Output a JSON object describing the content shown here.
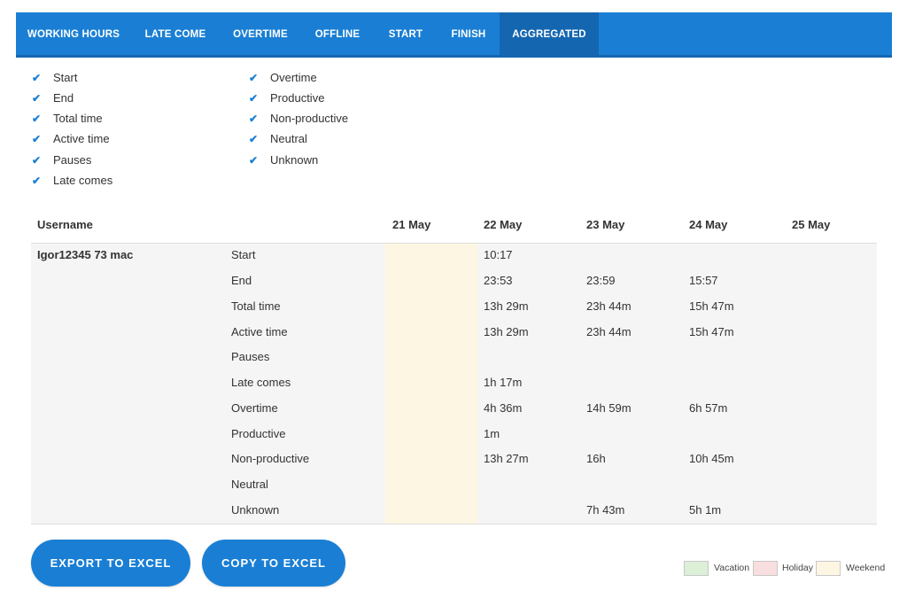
{
  "tabs": [
    {
      "label": "WORKING HOURS"
    },
    {
      "label": "LATE COME"
    },
    {
      "label": "OVERTIME"
    },
    {
      "label": "OFFLINE"
    },
    {
      "label": "START"
    },
    {
      "label": "FINISH"
    },
    {
      "label": "AGGREGATED",
      "active": true
    }
  ],
  "filters": {
    "left": [
      {
        "label": "Start",
        "checked": true
      },
      {
        "label": "End",
        "checked": true
      },
      {
        "label": "Total time",
        "checked": true
      },
      {
        "label": "Active time",
        "checked": true
      },
      {
        "label": "Pauses",
        "checked": true
      },
      {
        "label": "Late comes",
        "checked": true
      }
    ],
    "right": [
      {
        "label": "Overtime",
        "checked": true
      },
      {
        "label": "Productive",
        "checked": true
      },
      {
        "label": "Non-productive",
        "checked": true
      },
      {
        "label": "Neutral",
        "checked": true
      },
      {
        "label": "Unknown",
        "checked": true
      }
    ],
    "check_glyph": "✔"
  },
  "table": {
    "header": {
      "username": "Username",
      "days": [
        "21 May",
        "22 May",
        "23 May",
        "24 May",
        "25 May"
      ]
    },
    "user": "Igor12345 73 mac",
    "metrics": [
      {
        "label": "Start",
        "values": [
          "",
          "10:17",
          "",
          "",
          ""
        ]
      },
      {
        "label": "End",
        "values": [
          "",
          "23:53",
          "23:59",
          "15:57",
          ""
        ]
      },
      {
        "label": "Total time",
        "values": [
          "",
          "13h 29m",
          "23h 44m",
          "15h 47m",
          ""
        ]
      },
      {
        "label": "Active time",
        "values": [
          "",
          "13h 29m",
          "23h 44m",
          "15h 47m",
          ""
        ]
      },
      {
        "label": "Pauses",
        "values": [
          "",
          "",
          "",
          "",
          ""
        ]
      },
      {
        "label": "Late comes",
        "values": [
          "",
          "1h 17m",
          "",
          "",
          ""
        ]
      },
      {
        "label": "Overtime",
        "values": [
          "",
          "4h 36m",
          "14h 59m",
          "6h 57m",
          ""
        ]
      },
      {
        "label": "Productive",
        "values": [
          "",
          "1m",
          "",
          "",
          ""
        ]
      },
      {
        "label": "Non-productive",
        "values": [
          "",
          "13h 27m",
          "16h",
          "10h 45m",
          ""
        ]
      },
      {
        "label": "Neutral",
        "values": [
          "",
          "",
          "",
          "",
          ""
        ]
      },
      {
        "label": "Unknown",
        "values": [
          "",
          "",
          "7h 43m",
          "5h 1m",
          ""
        ]
      }
    ]
  },
  "buttons": {
    "export": "EXPORT TO EXCEL",
    "copy": "COPY TO EXCEL"
  },
  "legend": [
    {
      "label": "Vacation",
      "color": "#dcf0d8"
    },
    {
      "label": "Holiday",
      "color": "#f8dede"
    },
    {
      "label": "Weekend",
      "color": "#fdf6e3"
    }
  ],
  "colors": {
    "accent": "#1a7fd4",
    "accent_dark": "#1566b0"
  }
}
